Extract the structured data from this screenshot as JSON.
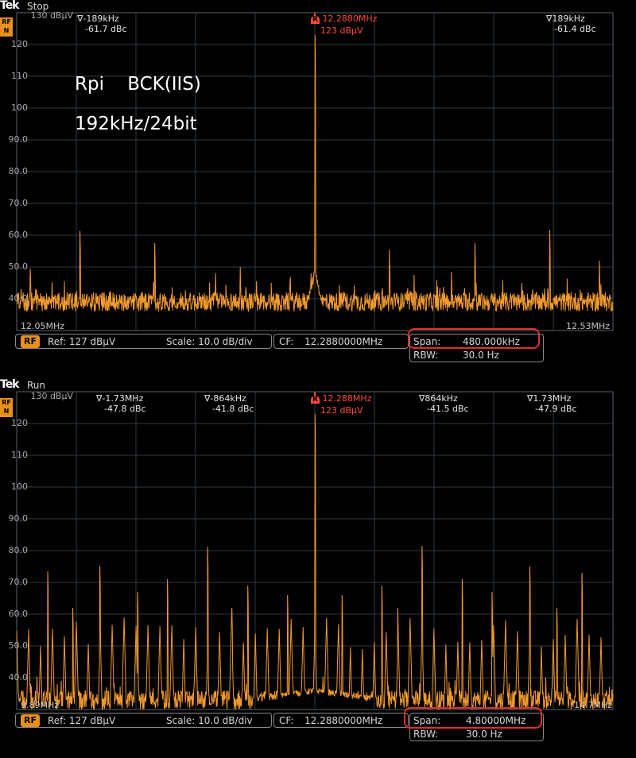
{
  "panels": [
    {
      "brand": "Tek",
      "state": "Stop",
      "rf_badge": "RF\nN",
      "top_ref_label": "130 dBµV",
      "y_ticks": [
        "120",
        "110",
        "100",
        "90.0",
        "80.0",
        "70.0",
        "60.0",
        "50.0",
        "40.0"
      ],
      "f_start": "12.05MHz",
      "f_stop": "12.53MHz",
      "annotation_line1": "Rpi    BCK(IIS)",
      "annotation_line2": "192kHz/24bit",
      "markers": [
        {
          "glyph": "∇",
          "freq": "-189kHz",
          "level": "-61.7 dBc",
          "ref": false
        },
        {
          "glyph": "R",
          "freq": "12.2880MHz",
          "level": "123 dBµV",
          "ref": true
        },
        {
          "glyph": "∇",
          "freq": "189kHz",
          "level": "-61.4 dBc",
          "ref": false
        }
      ],
      "readout": {
        "rf": "RF",
        "ref": "Ref: 127 dBµV",
        "scale": "Scale: 10.0 dB/div",
        "cf_label": "CF:",
        "cf_value": "12.2880000MHz",
        "span_label": "Span:",
        "span_value": "480.000kHz",
        "rbw_label": "RBW:",
        "rbw_value": "30.0 Hz"
      }
    },
    {
      "brand": "Tek",
      "state": "Run",
      "rf_badge": "RF\nN",
      "top_ref_label": "130 dBµV",
      "y_ticks": [
        "120",
        "110",
        "100",
        "90.0",
        "80.0",
        "70.0",
        "60.0",
        "50.0",
        "40.0"
      ],
      "f_start": "9.89MHz",
      "f_stop": "14.7MHz",
      "markers": [
        {
          "glyph": "∇",
          "freq": "-1.73MHz",
          "level": "-47.8 dBc",
          "ref": false
        },
        {
          "glyph": "∇",
          "freq": "-864kHz",
          "level": "-41.8 dBc",
          "ref": false
        },
        {
          "glyph": "R",
          "freq": "12.288MHz",
          "level": "123 dBµV",
          "ref": true
        },
        {
          "glyph": "∇",
          "freq": "864kHz",
          "level": "-41.5 dBc",
          "ref": false
        },
        {
          "glyph": "∇",
          "freq": "1.73MHz",
          "level": "-47.9 dBc",
          "ref": false
        }
      ],
      "readout": {
        "rf": "RF",
        "ref": "Ref: 127 dBµV",
        "scale": "Scale: 10.0 dB/div",
        "cf_label": "CF:",
        "cf_value": "12.2880000MHz",
        "span_label": "Span:",
        "span_value": "4.80000MHz",
        "rbw_label": "RBW:",
        "rbw_value": "30.0 Hz"
      }
    }
  ],
  "colors": {
    "trace": "#f29a2e",
    "grid": "#2f3a44",
    "highlight": "#e03030",
    "ref_marker": "#ff4a3a"
  },
  "chart_data": [
    {
      "type": "line",
      "x_unit": "MHz",
      "y_unit": "dBµV",
      "xlim": [
        12.048,
        12.528
      ],
      "ylim": [
        30,
        130
      ],
      "grid": true,
      "noise_floor": 39,
      "peaks": [
        {
          "x": 12.288,
          "y": 123
        },
        {
          "x": 12.099,
          "y": 61.3
        },
        {
          "x": 12.477,
          "y": 61.6
        },
        {
          "x": 12.059,
          "y": 49.5
        },
        {
          "x": 12.159,
          "y": 57.5
        },
        {
          "x": 12.208,
          "y": 48
        },
        {
          "x": 12.228,
          "y": 50
        },
        {
          "x": 12.253,
          "y": 45
        },
        {
          "x": 12.268,
          "y": 45
        },
        {
          "x": 12.285,
          "y": 48
        },
        {
          "x": 12.348,
          "y": 55.5
        },
        {
          "x": 12.368,
          "y": 47.5
        },
        {
          "x": 12.398,
          "y": 48.5
        },
        {
          "x": 12.418,
          "y": 45
        },
        {
          "x": 12.417,
          "y": 57.5
        },
        {
          "x": 12.517,
          "y": 52
        }
      ]
    },
    {
      "type": "line",
      "x_unit": "MHz",
      "y_unit": "dBµV",
      "xlim": [
        9.888,
        14.688
      ],
      "ylim": [
        30,
        130
      ],
      "grid": true,
      "noise_floor": 33,
      "peaks": [
        {
          "x": 12.288,
          "y": 123
        },
        {
          "x": 11.424,
          "y": 81.2
        },
        {
          "x": 13.152,
          "y": 81.5
        },
        {
          "x": 10.558,
          "y": 75.2
        },
        {
          "x": 14.018,
          "y": 75.1
        },
        {
          "x": 10.138,
          "y": 73.5
        },
        {
          "x": 14.438,
          "y": 73
        },
        {
          "x": 11.102,
          "y": 71
        },
        {
          "x": 13.474,
          "y": 71
        },
        {
          "x": 11.748,
          "y": 69
        },
        {
          "x": 12.828,
          "y": 69
        },
        {
          "x": 10.86,
          "y": 67
        },
        {
          "x": 13.716,
          "y": 67
        },
        {
          "x": 12.07,
          "y": 66
        },
        {
          "x": 12.506,
          "y": 66
        },
        {
          "x": 10.34,
          "y": 62
        },
        {
          "x": 11.62,
          "y": 62
        },
        {
          "x": 12.956,
          "y": 62
        },
        {
          "x": 14.236,
          "y": 62
        }
      ],
      "comb_spacing": 0.096,
      "comb_level": 52
    }
  ]
}
